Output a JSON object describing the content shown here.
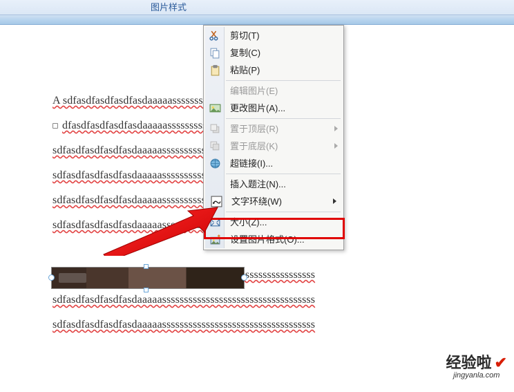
{
  "ribbon": {
    "tab_label": "图片样式"
  },
  "doc": {
    "line1": "A sdfasdfasdfasdfasdaaaaassssssssssssssssssssssssssssssssss",
    "line2": "dfasdfasdfasdfasdaaaaasssssssssssssssssssssssssssssssssssssss",
    "line3": "sdfasdfasdfasdfasdaaaaasssssssssssssssssssssssssssssssssss",
    "line4": "sdfasdfasdfasdfasdaaaaasssssssssssssssssssssssssssssssssss",
    "line5": "sdfasdfasdfasdfasdaaaaasssssssssssssssssssssssssssssssssssss",
    "line6": "sdfasdfasdfasdfasdaaaaassssssssssssssssssssssssssssssssssss",
    "line7": "sdfasdfasdfasdfasdaaaaasssssssssssssssssssssssssssssssssss",
    "line8": "sdfasdfasdfasdfasdaaaaasssssssssssssssssssssssssssssssssss",
    "line9": "sdfasdfasdfasdfasdaaaaasssssssssssssssssssssssssssssssssss"
  },
  "menu": {
    "cut": {
      "label": "剪切(T)",
      "shortcut": "T"
    },
    "copy": {
      "label": "复制(C)",
      "shortcut": "C"
    },
    "paste": {
      "label": "粘贴(P)",
      "shortcut": "P"
    },
    "edit_picture": {
      "label": "编辑图片(E)",
      "shortcut": "E"
    },
    "change_picture": {
      "label": "更改图片(A)...",
      "shortcut": "A"
    },
    "bring_to_front": {
      "label": "置于顶层(R)",
      "shortcut": "R"
    },
    "send_to_back": {
      "label": "置于底层(K)",
      "shortcut": "K"
    },
    "hyperlink": {
      "label": "超链接(I)...",
      "shortcut": "I"
    },
    "insert_caption": {
      "label": "插入题注(N)...",
      "shortcut": "N"
    },
    "text_wrapping": {
      "label": "文字环绕(W)",
      "shortcut": "W"
    },
    "size": {
      "label": "大小(Z)...",
      "shortcut": "Z"
    },
    "format_picture": {
      "label": "设置图片格式(O)...",
      "shortcut": "O"
    }
  },
  "watermark": {
    "cn": "经验啦",
    "url": "jingyanla.com"
  }
}
